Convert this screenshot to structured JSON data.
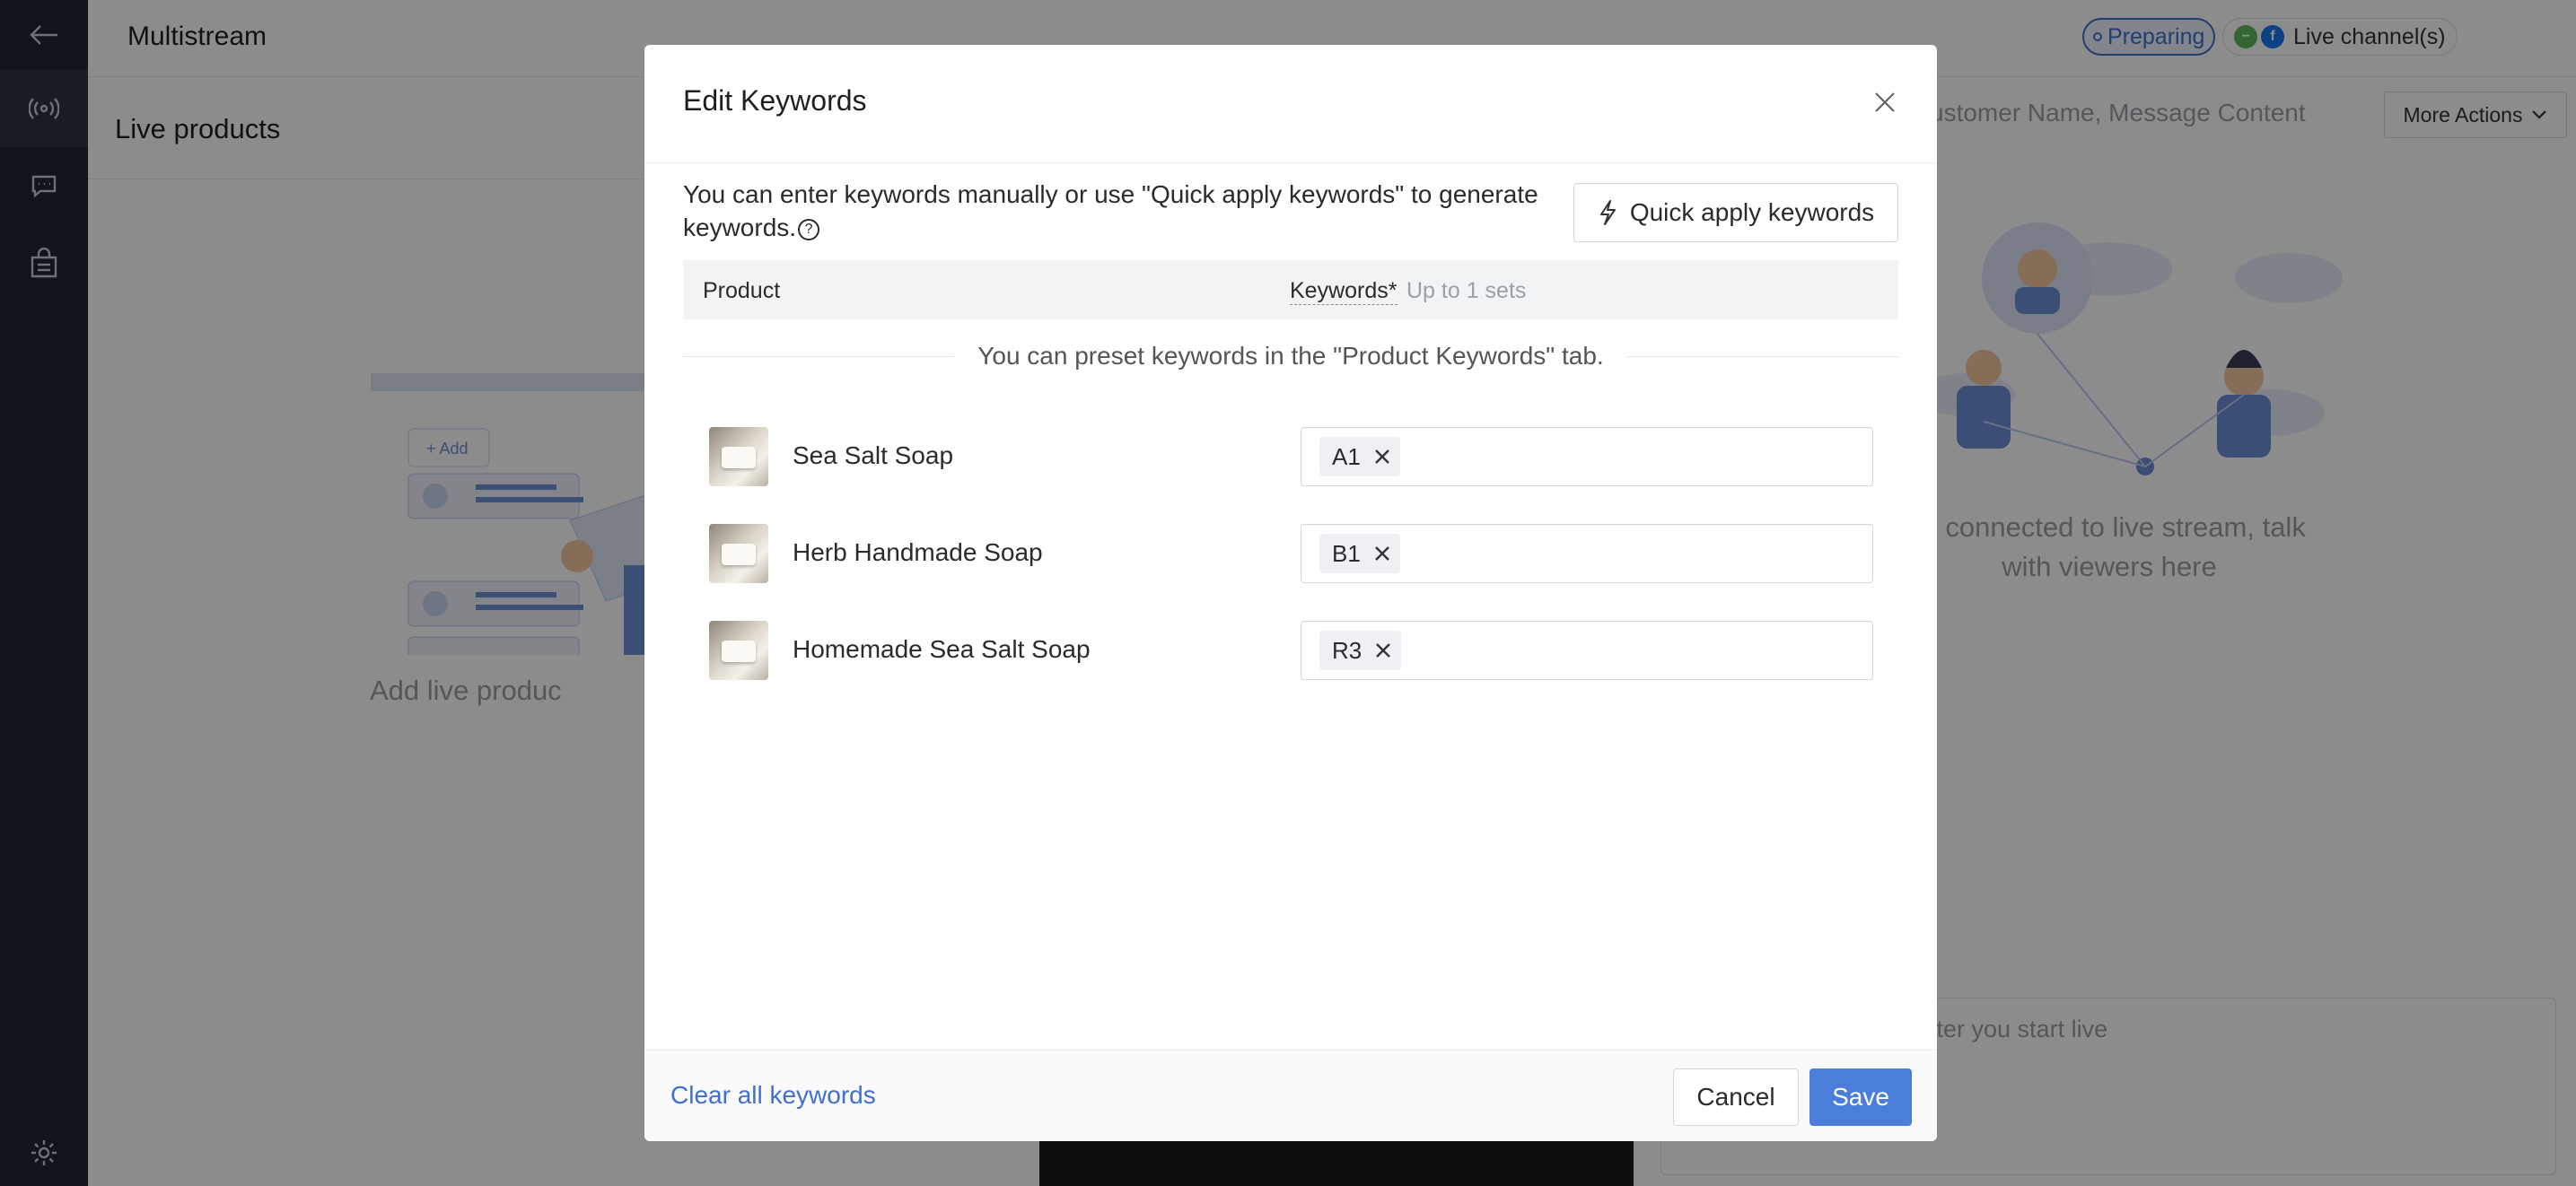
{
  "app": {
    "title": "Multistream",
    "status": "Preparing",
    "channels_label": "Live channel(s)"
  },
  "colors": {
    "accent": "#4b7ddb",
    "link": "#3f6fd0",
    "rail": "#1f2633"
  },
  "sidebar": {
    "icons": [
      "back-arrow-icon",
      "broadcast-icon",
      "chat-icon",
      "shopping-bag-icon",
      "gear-icon"
    ]
  },
  "left_panel": {
    "title": "Live products",
    "empty_text": "Add live produc"
  },
  "right_panel": {
    "search_placeholder": "ustomer Name, Message Content",
    "more_actions": "More Actions",
    "empty_text": "er connected to live stream, talk with viewers here",
    "composer_placeholder": "after you start live"
  },
  "modal": {
    "title": "Edit Keywords",
    "intro": "You can enter keywords manually or use \"Quick apply keywords\" to generate keywords.",
    "quick_apply": "Quick apply keywords",
    "col_product": "Product",
    "col_keywords": "Keywords*",
    "col_keywords_hint": "Up to 1 sets",
    "preset_note": "You can preset keywords in the \"Product Keywords\" tab.",
    "rows": [
      {
        "name": "Sea Salt Soap",
        "keyword": "A1"
      },
      {
        "name": "Herb Handmade Soap",
        "keyword": "B1"
      },
      {
        "name": "Homemade Sea Salt Soap",
        "keyword": "R3"
      }
    ],
    "clear_all": "Clear all keywords",
    "cancel": "Cancel",
    "save": "Save"
  }
}
